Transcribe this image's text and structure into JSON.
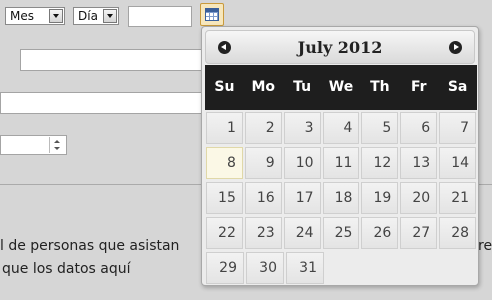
{
  "form": {
    "month_select": "Mes",
    "day_select": "Día",
    "date_input": ""
  },
  "paragraph": {
    "line1": "l de personas que asistan",
    "line1_tail": "re",
    "line2": "que los datos aquí"
  },
  "datepicker": {
    "title": "July 2012",
    "weekdays": [
      "Su",
      "Mo",
      "Tu",
      "We",
      "Th",
      "Fr",
      "Sa"
    ],
    "weeks": [
      [
        "",
        "1",
        "2",
        "3",
        "4",
        "5",
        "6",
        "7"
      ],
      [
        "8",
        "9",
        "10",
        "11",
        "12",
        "13",
        "14"
      ],
      [
        "15",
        "16",
        "17",
        "18",
        "19",
        "20",
        "21"
      ],
      [
        "22",
        "23",
        "24",
        "25",
        "26",
        "27",
        "28"
      ],
      [
        "29",
        "30",
        "31",
        "",
        "",
        "",
        ""
      ]
    ],
    "today": "8"
  },
  "icons": {
    "calendar_button": "calendar-icon",
    "prev": "prev-month-icon",
    "next": "next-month-icon"
  }
}
